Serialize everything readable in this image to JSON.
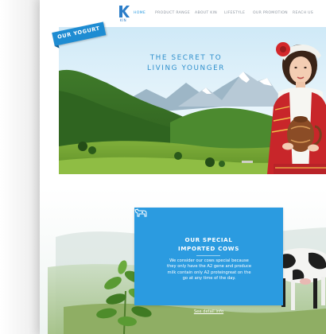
{
  "brand": {
    "logo_text": "KIN",
    "accent": "#2b9be0",
    "dark_accent": "#1e8cd2"
  },
  "nav": {
    "items": [
      "HOME",
      "PRODUCT RANGE",
      "ABOUT KIN",
      "LIFESTYLE",
      "OUR PROMOTION",
      "REACH US"
    ],
    "active": "HOME"
  },
  "hero": {
    "ribbon_label": "OUR YOGURT",
    "headline": "THE SECRET TO\nLIVING YOUNGER"
  },
  "feature": {
    "icon": "cow-icon",
    "title": "OUR SPECIAL\nIMPORTED COWS",
    "body": "We consider our cows special because they only have the A2 gene and produce milk contain only A2 proteingreat on the go at any time of the day.",
    "link": "See detail info"
  }
}
